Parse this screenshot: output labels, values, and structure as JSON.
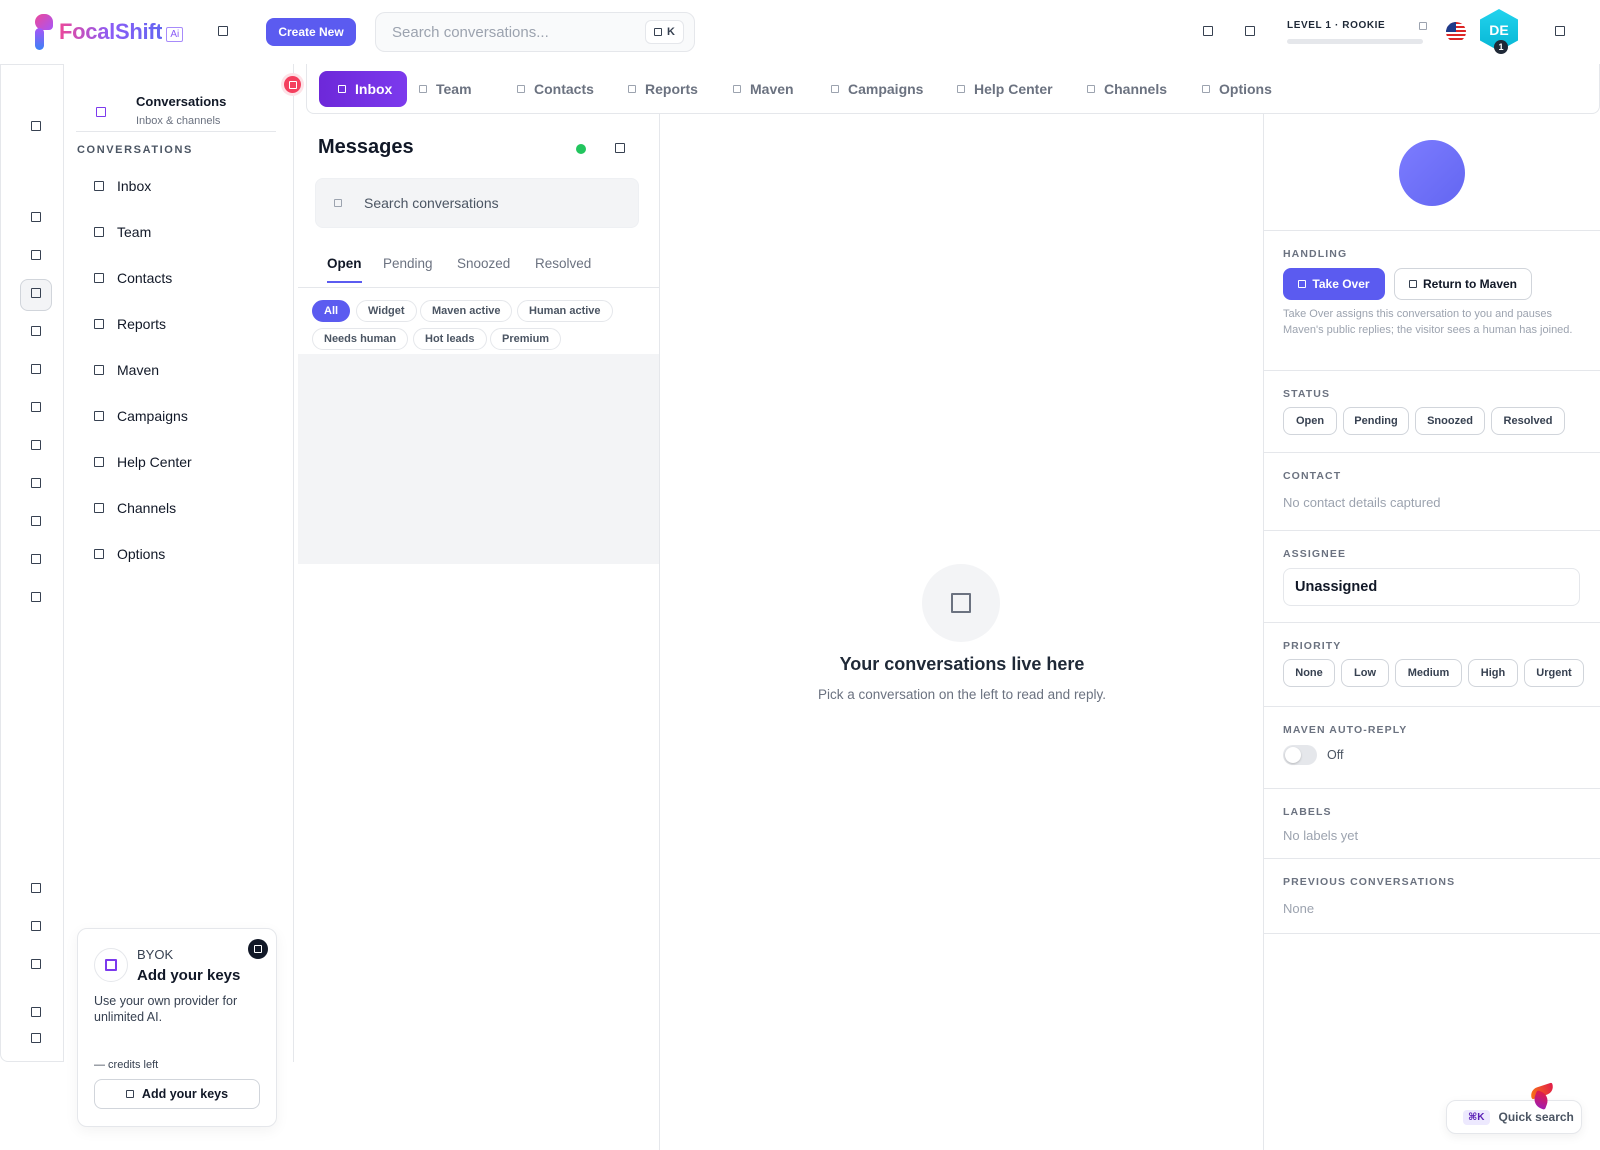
{
  "brand": {
    "name": "FocalShift",
    "badge": "Ai"
  },
  "topbar": {
    "create_label": "Create New",
    "search_placeholder": "Search conversations...",
    "search_shortcut": "K",
    "level_label": "LEVEL 1 · ROOKIE",
    "level_progress": 0,
    "avatar_initials": "DE",
    "avatar_level": "1"
  },
  "sidebar": {
    "title": "Conversations",
    "subtitle": "Inbox & channels",
    "section": "CONVERSATIONS",
    "items": [
      "Inbox",
      "Team",
      "Contacts",
      "Reports",
      "Maven",
      "Campaigns",
      "Help Center",
      "Channels",
      "Options"
    ]
  },
  "byok": {
    "label": "BYOK",
    "title": "Add your keys",
    "description": "Use your own provider for unlimited AI.",
    "credits": "— credits left",
    "button": "Add your keys"
  },
  "tabs": [
    "Inbox",
    "Team",
    "Contacts",
    "Reports",
    "Maven",
    "Campaigns",
    "Help Center",
    "Channels",
    "Options"
  ],
  "messages": {
    "title": "Messages",
    "search_placeholder": "Search conversations",
    "status_tabs": [
      "Open",
      "Pending",
      "Snoozed",
      "Resolved"
    ],
    "filters": [
      "All",
      "Widget",
      "Maven active",
      "Human active",
      "Needs human",
      "Hot leads",
      "Premium"
    ]
  },
  "empty": {
    "title": "Your conversations live here",
    "subtitle": "Pick a conversation on the left to read and reply."
  },
  "panel": {
    "handling_label": "HANDLING",
    "take_over": "Take Over",
    "return_to_maven": "Return to Maven",
    "handling_note": "Take Over assigns this conversation to you and pauses Maven's public replies; the visitor sees a human has joined.",
    "status_label": "STATUS",
    "status_options": [
      "Open",
      "Pending",
      "Snoozed",
      "Resolved"
    ],
    "contact_label": "CONTACT",
    "contact_value": "No contact details captured",
    "assignee_label": "ASSIGNEE",
    "assignee_value": "Unassigned",
    "priority_label": "PRIORITY",
    "priority_options": [
      "None",
      "Low",
      "Medium",
      "High",
      "Urgent"
    ],
    "autoreply_label": "MAVEN AUTO-REPLY",
    "autoreply_value": "Off",
    "labels_label": "LABELS",
    "labels_value": "No labels yet",
    "previous_label": "PREVIOUS CONVERSATIONS",
    "previous_value": "None"
  },
  "quick_search": {
    "shortcut": "⌘K",
    "label": "Quick search"
  },
  "colors": {
    "accent": "#5b5bf0",
    "tab_active": "#6d28d9",
    "online": "#22c55e",
    "badge": "#f43f5e"
  }
}
